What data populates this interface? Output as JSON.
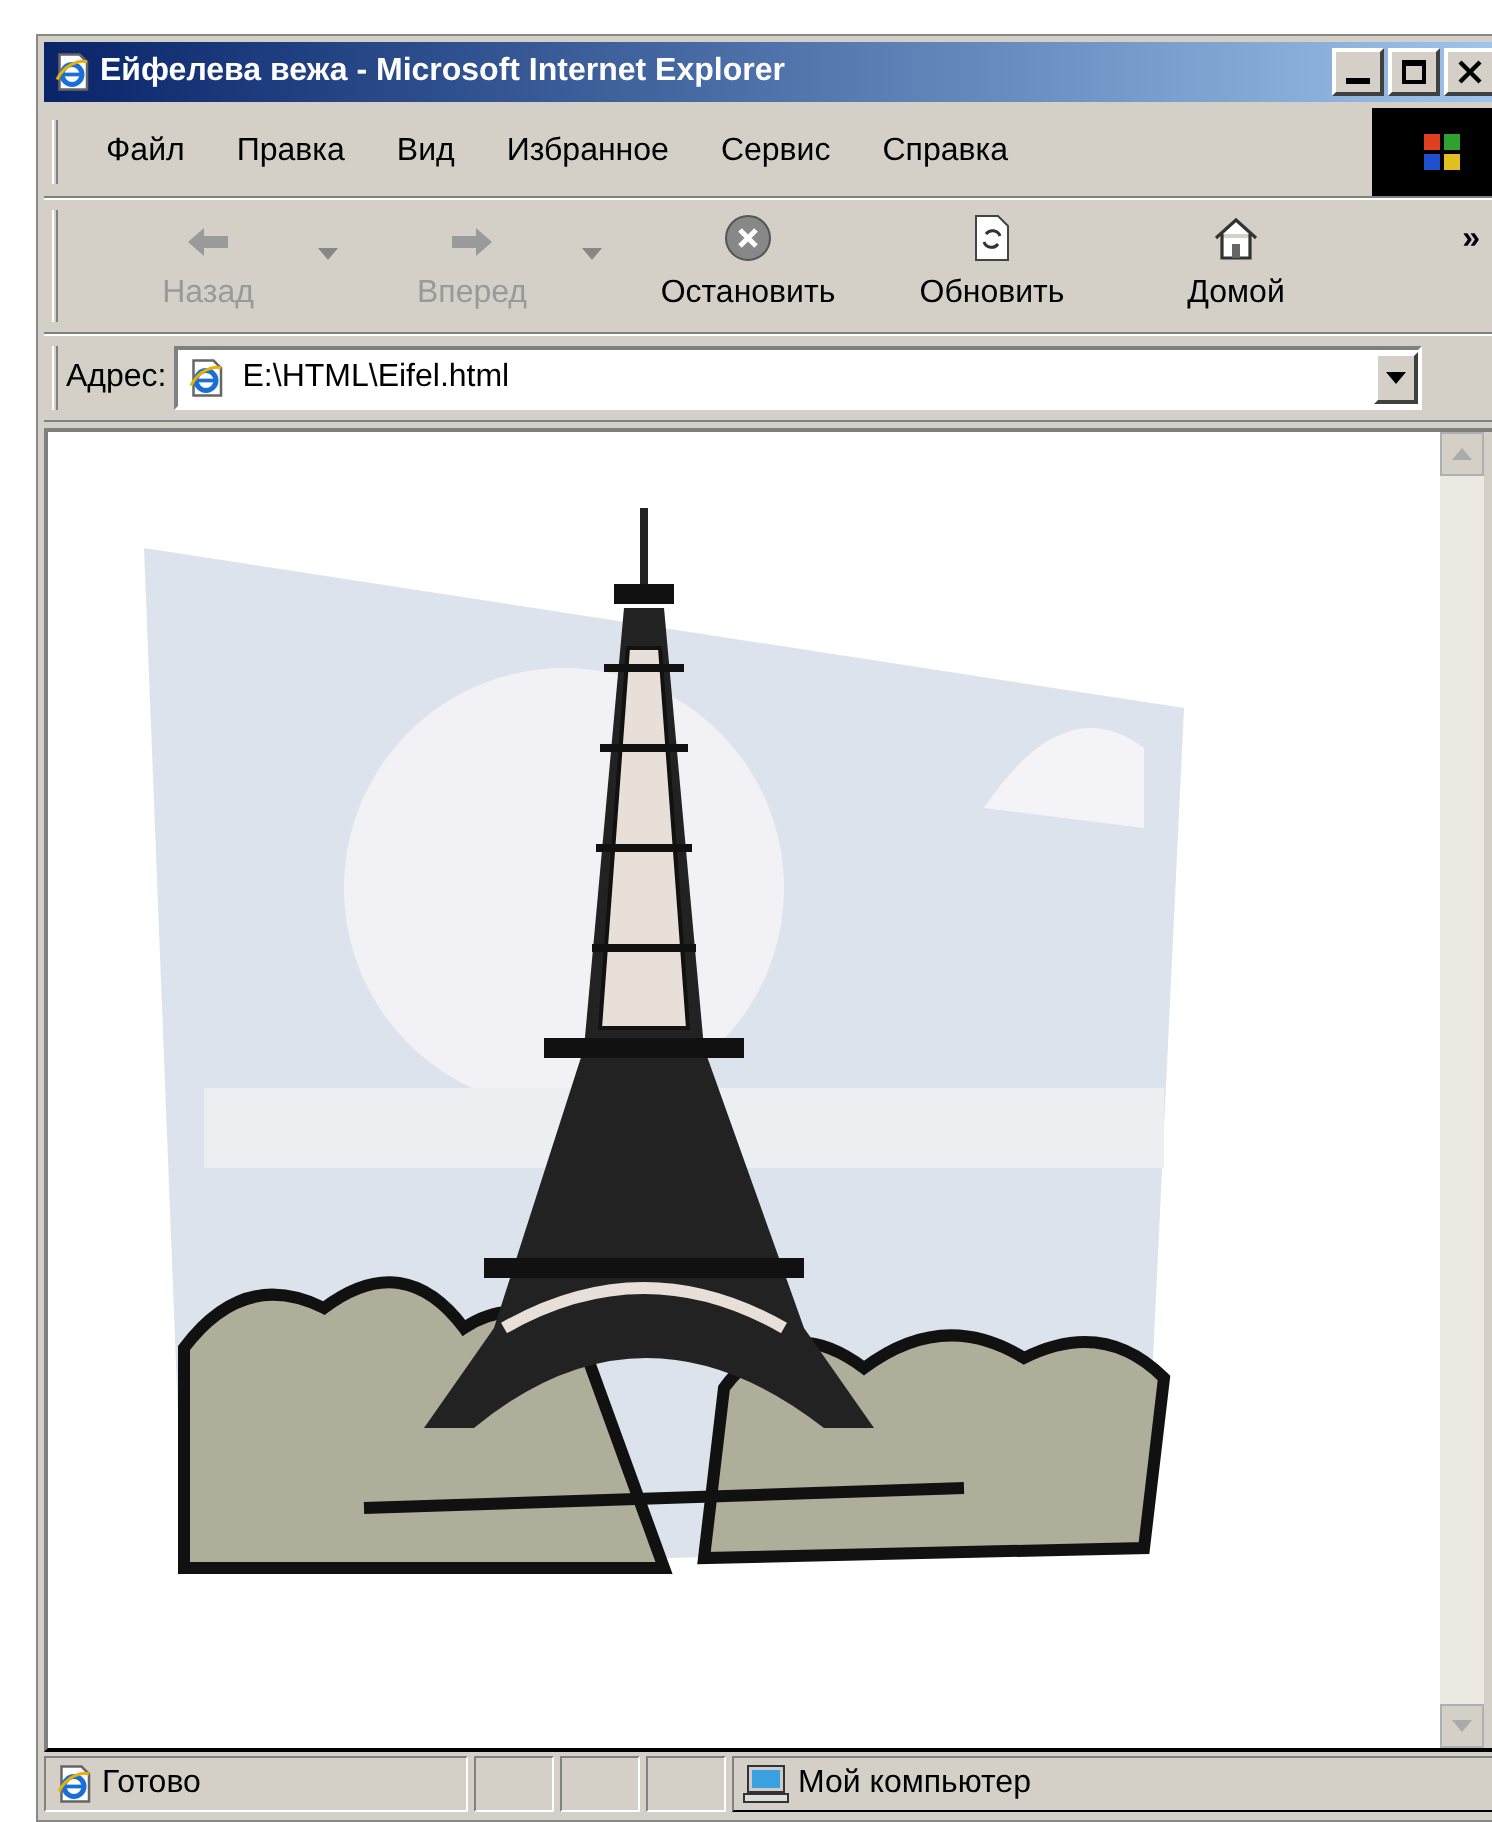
{
  "window": {
    "title": "Ейфелева вежа - Microsoft Internet Explorer"
  },
  "menu": [
    "Файл",
    "Правка",
    "Вид",
    "Избранное",
    "Сервис",
    "Справка"
  ],
  "toolbar": [
    {
      "kind": "back",
      "label": "Назад",
      "disabled": true,
      "dropdown": true
    },
    {
      "kind": "forward",
      "label": "Вперед",
      "disabled": true,
      "dropdown": true
    },
    {
      "kind": "stop",
      "label": "Остановить",
      "disabled": false,
      "dropdown": false
    },
    {
      "kind": "refresh",
      "label": "Обновить",
      "disabled": false,
      "dropdown": false
    },
    {
      "kind": "home",
      "label": "Домой",
      "disabled": false,
      "dropdown": false
    }
  ],
  "toolbar_overflow": "»",
  "address": {
    "label": "Адрес:",
    "value": "E:\\HTML\\Eifel.html"
  },
  "status_bar": {
    "status": "Готово",
    "zone": "Мой компьютер"
  }
}
